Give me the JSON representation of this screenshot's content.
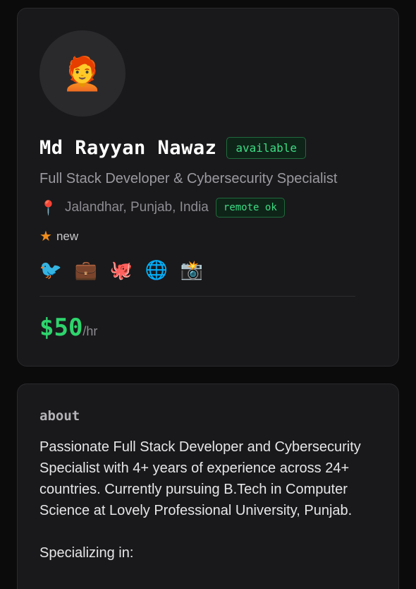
{
  "profile": {
    "avatar_emoji": "🧑‍🦰",
    "name": "Md Rayyan Nawaz",
    "status_badge": "available",
    "title": "Full Stack Developer & Cybersecurity Specialist",
    "location": "Jalandhar, Punjab, India",
    "remote_badge": "remote ok",
    "rating_label": "new",
    "social_links": [
      {
        "icon": "bird-icon",
        "glyph": "🐦"
      },
      {
        "icon": "briefcase-icon",
        "glyph": "💼"
      },
      {
        "icon": "octopus-icon",
        "glyph": "🐙"
      },
      {
        "icon": "globe-icon",
        "glyph": "🌐"
      },
      {
        "icon": "camera-icon",
        "glyph": "📸"
      }
    ],
    "rate_amount": "$50",
    "rate_unit": "/hr"
  },
  "about": {
    "heading": "about",
    "paragraph": "Passionate Full Stack Developer and Cybersecurity Specialist with 4+ years of experience across 24+ countries. Currently pursuing B.Tech in Computer Science at Lovely Professional University, Punjab.",
    "specializing_label": "Specializing in:"
  },
  "colors": {
    "accent_green": "#2ed46d",
    "badge_green": "#3ddc84",
    "star_orange": "#f08c1d",
    "card_bg": "#19191b",
    "page_bg": "#0b0b0c"
  }
}
